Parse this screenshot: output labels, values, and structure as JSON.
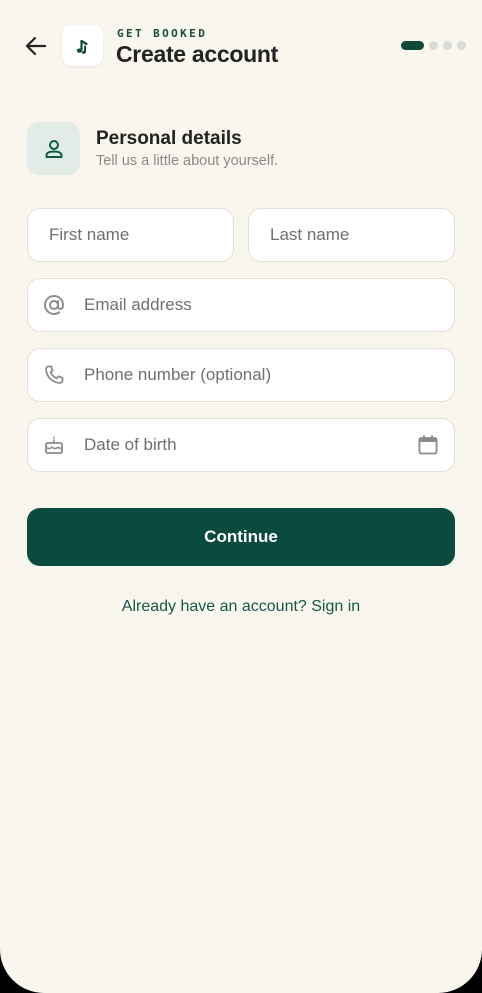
{
  "header": {
    "eyebrow": "GET BOOKED",
    "title": "Create account",
    "steps_total": 4,
    "current_step": 1
  },
  "section": {
    "title": "Personal details",
    "subtitle": "Tell us a little about yourself."
  },
  "form": {
    "first_name": {
      "value": "",
      "placeholder": "First name"
    },
    "last_name": {
      "value": "",
      "placeholder": "Last name"
    },
    "email": {
      "value": "",
      "placeholder": "Email address"
    },
    "phone": {
      "value": "",
      "placeholder": "Phone number (optional)"
    },
    "dob": {
      "value": "",
      "placeholder": "Date of birth"
    }
  },
  "actions": {
    "continue_label": "Continue",
    "signin_label": "Already have an account? Sign in"
  },
  "icons": {
    "back": "arrow-left-icon",
    "logo": "music-note-icon",
    "section": "person-icon",
    "email": "at-sign-icon",
    "phone": "phone-icon",
    "dob": "cake-icon",
    "calendar": "calendar-icon"
  },
  "colors": {
    "background": "#f9f6ee",
    "primary": "#0b4a3e",
    "accent_text": "#17564a",
    "section_icon_bg": "#e3ebe6",
    "step_inactive": "#d6ddd7"
  }
}
